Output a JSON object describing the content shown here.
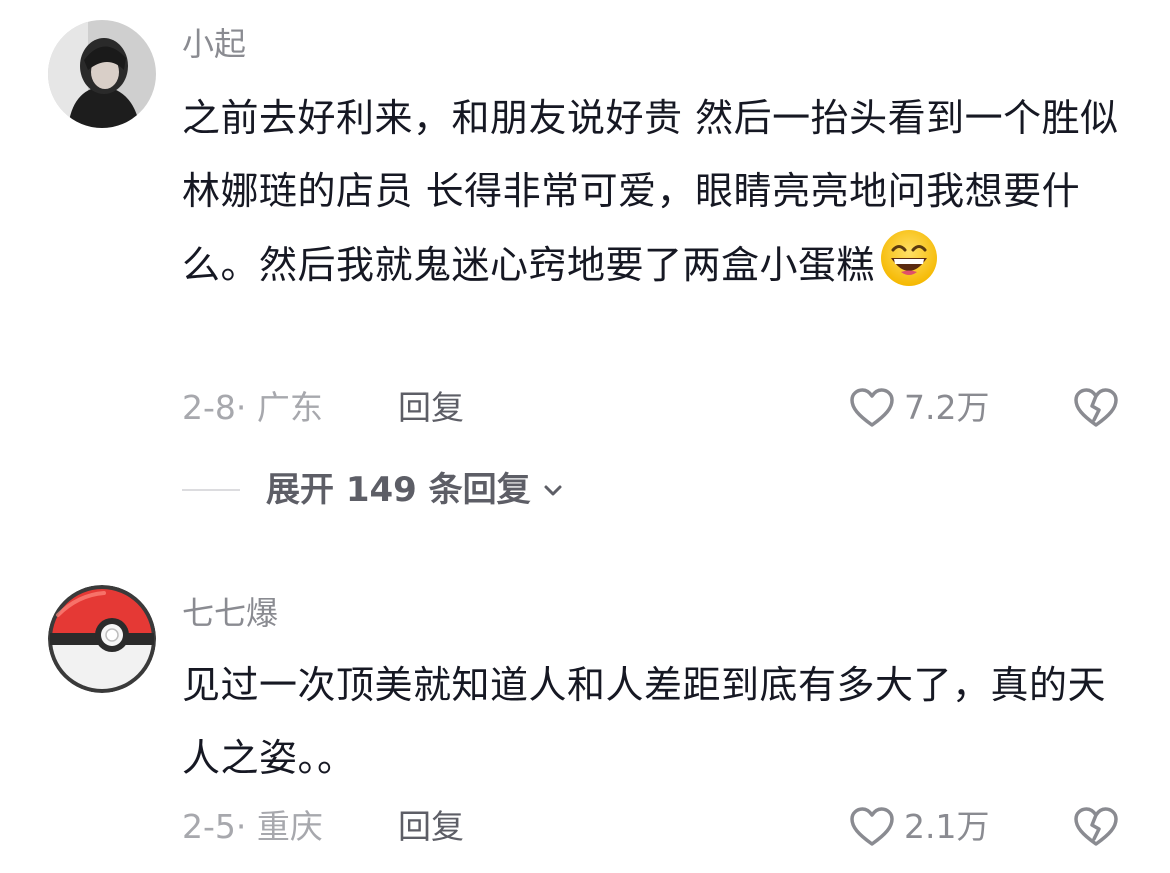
{
  "comments": [
    {
      "username": "小起",
      "text": "之前去好利来，和朋友说好贵 然后一抬头看到一个胜似林娜琏的店员 长得非常可爱，眼睛亮亮地问我想要什么。然后我就鬼迷心窍地要了两盒小蛋糕",
      "emoji": "grinning-face-emoji",
      "meta": "2-8· 广东",
      "reply_label": "回复",
      "likes": "7.2万",
      "expand_label": "展开 149 条回复"
    },
    {
      "username": "七七爆",
      "text": "见过一次顶美就知道人和人差距到底有多大了，真的天人之姿。。",
      "meta": "2-5· 重庆",
      "reply_label": "回复",
      "likes": "2.1万"
    }
  ],
  "colors": {
    "text_primary": "#161823",
    "text_secondary": "#8a8b91",
    "text_meta": "#a7a8ad",
    "pokeball_red": "#e53935"
  }
}
